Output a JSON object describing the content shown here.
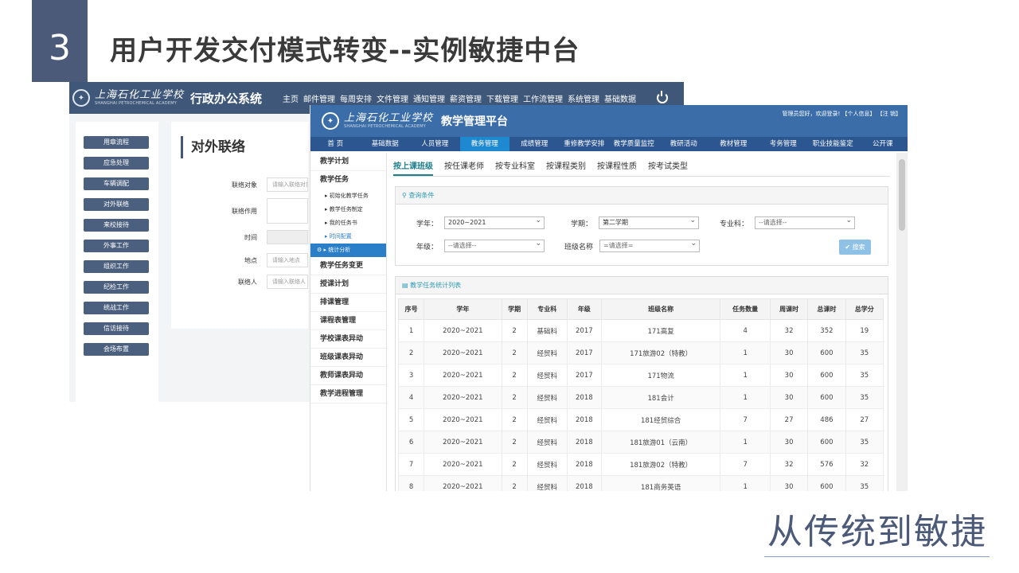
{
  "slide": {
    "number": "3",
    "title": "用户开发交付模式转变--实例敏捷中台",
    "closing": "从传统到敏捷"
  },
  "back_window": {
    "logo_cn": "上海石化工业学校",
    "logo_en": "SHANGHAI PETROCHEMICAL ACADEMY",
    "system_name": "行政办公系统",
    "nav": [
      "主页",
      "邮件管理",
      "每周安排",
      "文件管理",
      "通知管理",
      "薪资管理",
      "下载管理",
      "工作流管理",
      "系统管理",
      "基础数据"
    ],
    "sidebar": [
      "用章流程",
      "应急处理",
      "车辆调配",
      "对外联络",
      "来校接待",
      "外事工作",
      "组织工作",
      "纪检工作",
      "统战工作",
      "信访接待",
      "会场布置"
    ],
    "page_title": "对外联络",
    "form": [
      {
        "label": "联络对象",
        "placeholder": "请输入联络对象"
      },
      {
        "label": "联络作用",
        "placeholder": ""
      },
      {
        "label": "时间",
        "placeholder": ""
      },
      {
        "label": "地点",
        "placeholder": "请输入地点"
      },
      {
        "label": "联络人",
        "placeholder": "请输入联络人"
      }
    ]
  },
  "front_window": {
    "platform_name": "教学管理平台",
    "user_info": "管理员您好，欢迎登录!  【个人信息】 【注 销】",
    "nav": [
      "首 页",
      "基础数据",
      "人员管理",
      "教务管理",
      "成绩管理",
      "重修教学安排",
      "教学质量监控",
      "教研活动",
      "教材管理",
      "考务管理",
      "职业技能鉴定",
      "公开课"
    ],
    "nav_active": "教务管理",
    "sidebar": {
      "item_plan": "教学计划",
      "item_task": "教学任务",
      "sub_init": "初始化教学任务",
      "sub_make": "教学任务制定",
      "sub_mine": "我的任务书",
      "sub_time": "时间配置",
      "sub_stats": "统计分析",
      "items_after": [
        "教学任务变更",
        "授课计划",
        "排课管理",
        "课程表管理",
        "学校课表异动",
        "班级课表异动",
        "教师课表异动",
        "教学进程管理"
      ]
    },
    "tabs": [
      "按上课班级",
      "按任课老师",
      "按专业科室",
      "按课程类别",
      "按课程性质",
      "按考试类型"
    ],
    "query": {
      "title": "查询条件",
      "year_label": "学年：",
      "year_value": "2020~2021",
      "term_label": "学期：",
      "term_value": "第二学期",
      "dept_label": "专业科：",
      "dept_value": "--请选择--",
      "grade_label": "年级：",
      "grade_value": "--请选择--",
      "class_label": "班级名称",
      "class_value": "=请选择=",
      "search_label": "✔ 搜索"
    },
    "list_title": "教学任务统计列表",
    "table": {
      "headers": [
        "序号",
        "学年",
        "学期",
        "专业科",
        "年级",
        "班级名称",
        "任务数量",
        "周课时",
        "总课时",
        "总学分"
      ],
      "rows": [
        [
          "1",
          "2020~2021",
          "2",
          "基础科",
          "2017",
          "171高复",
          "4",
          "32",
          "352",
          "19"
        ],
        [
          "2",
          "2020~2021",
          "2",
          "经贸科",
          "2017",
          "171旅游02（特教）",
          "1",
          "30",
          "600",
          "35"
        ],
        [
          "3",
          "2020~2021",
          "2",
          "经贸科",
          "2017",
          "171物流",
          "1",
          "30",
          "600",
          "35"
        ],
        [
          "4",
          "2020~2021",
          "2",
          "经贸科",
          "2018",
          "181会计",
          "1",
          "30",
          "600",
          "35"
        ],
        [
          "5",
          "2020~2021",
          "2",
          "经贸科",
          "2018",
          "181经贸综合",
          "7",
          "27",
          "486",
          "27"
        ],
        [
          "6",
          "2020~2021",
          "2",
          "经贸科",
          "2018",
          "181旅游01（云南）",
          "1",
          "30",
          "600",
          "35"
        ],
        [
          "7",
          "2020~2021",
          "2",
          "经贸科",
          "2018",
          "181旅游02（特教）",
          "7",
          "32",
          "576",
          "32"
        ],
        [
          "8",
          "2020~2021",
          "2",
          "经贸科",
          "2018",
          "181商务英语",
          "1",
          "30",
          "600",
          "35"
        ]
      ]
    }
  }
}
